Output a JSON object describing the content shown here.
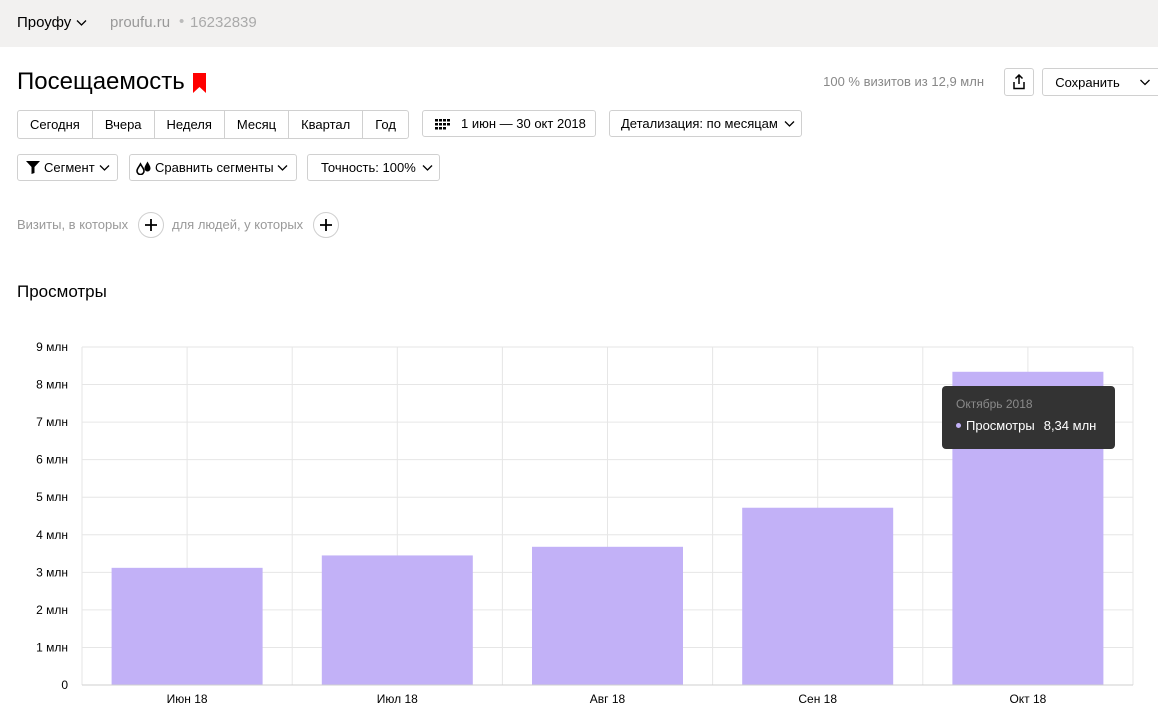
{
  "header": {
    "counter_name": "Проуфу",
    "site": "proufu.ru",
    "separator": "•",
    "counter_id": "16232839"
  },
  "report": {
    "title": "Посещаемость",
    "visits_info": "100 % визитов из 12,9 млн",
    "save_label": "Сохранить",
    "bookmark_color": "#ff0000"
  },
  "periods": [
    "Сегодня",
    "Вчера",
    "Неделя",
    "Месяц",
    "Квартал",
    "Год"
  ],
  "date_range": "1 июн — 30 окт 2018",
  "detail": "Детализация: по месяцам",
  "segment": "Сегмент",
  "compare": "Сравнить сегменты",
  "accuracy": "Точность: 100%",
  "filters": {
    "visits_label": "Визиты, в которых",
    "people_label": "для людей, у которых"
  },
  "tooltip": {
    "title": "Октябрь 2018",
    "series": "Просмотры",
    "value": "8,34 млн"
  },
  "chart_data": {
    "type": "bar",
    "title": "Просмотры",
    "categories": [
      "Июн 18",
      "Июл 18",
      "Авг 18",
      "Сен 18",
      "Окт 18"
    ],
    "series": [
      {
        "name": "Просмотры",
        "values": [
          3.12,
          3.45,
          3.68,
          4.72,
          8.34
        ]
      }
    ],
    "ylim": [
      0,
      9
    ],
    "yticks": [
      "0",
      "1 млн",
      "2 млн",
      "3 млн",
      "4 млн",
      "5 млн",
      "6 млн",
      "7 млн",
      "8 млн",
      "9 млн"
    ],
    "grid": true,
    "bar_color": "#c2b1f7"
  }
}
